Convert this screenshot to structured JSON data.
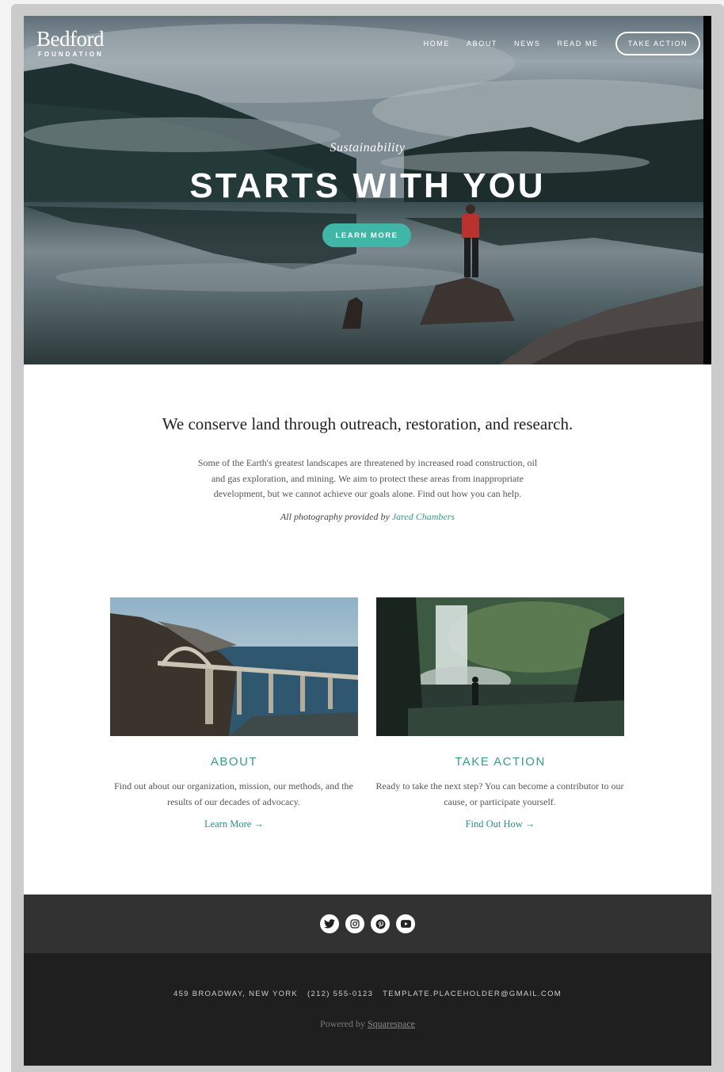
{
  "logo": {
    "name": "Bedford",
    "sub": "FOUNDATION"
  },
  "nav": {
    "items": [
      "HOME",
      "ABOUT",
      "NEWS",
      "READ ME"
    ],
    "cta": "TAKE ACTION"
  },
  "hero": {
    "kicker": "Sustainability",
    "title": "STARTS WITH YOU",
    "button": "LEARN MORE",
    "accent": "#3fb6a6"
  },
  "intro": {
    "heading": "We conserve land through outreach, restoration, and research.",
    "body": "Some of the Earth's greatest landscapes are threatened by increased road construction, oil and gas exploration, and mining. We aim to protect these areas from inappropriate development, but we cannot achieve our goals alone. Find out how you can help.",
    "credit_prefix": "All photography provided by",
    "credit_name": "Jared Chambers"
  },
  "cards": [
    {
      "title": "ABOUT",
      "text": "Find out about our organization, mission, our methods, and the results of our decades of advocacy.",
      "link": "Learn More →"
    },
    {
      "title": "TAKE ACTION",
      "text": "Ready to take the next step? You can become a contributor to our cause, or participate yourself.",
      "link": "Find Out How →"
    }
  ],
  "social": [
    "twitter-icon",
    "instagram-icon",
    "pinterest-icon",
    "youtube-icon"
  ],
  "footer": {
    "address": "459 BROADWAY, NEW YORK",
    "phone": "(212) 555-0123",
    "email": "TEMPLATE.PLACEHOLDER@GMAIL.COM",
    "powered_prefix": "Powered by",
    "powered_link": "Squarespace"
  }
}
